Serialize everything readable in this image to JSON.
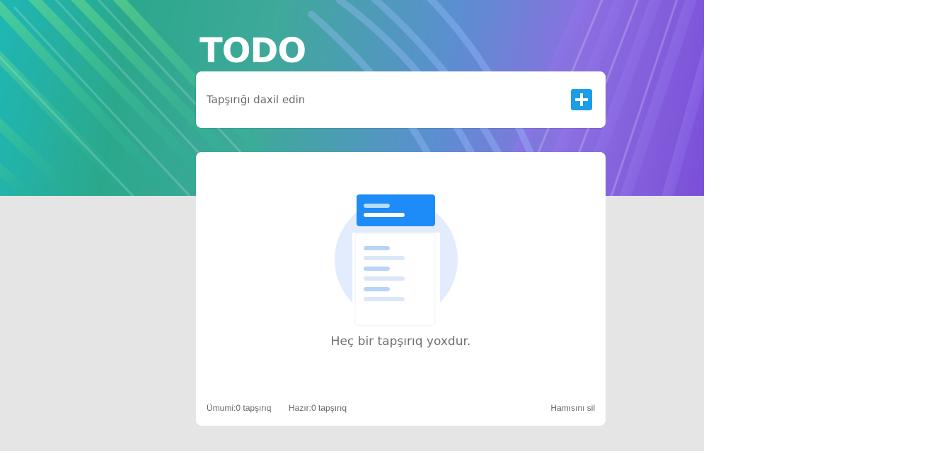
{
  "header": {
    "title": "TODO"
  },
  "task_input": {
    "placeholder": "Tapşırığı daxil edin",
    "value": ""
  },
  "add_button": {
    "icon": "plus-icon",
    "color": "#1a9ee8"
  },
  "task_list": {
    "items": [],
    "empty_message": "Heç bir tapşırıq yoxdur."
  },
  "footer": {
    "total_label": "Ümumi:",
    "total_count": "0",
    "total_unit": "tapşırıq",
    "done_label": "Hazır:",
    "done_count": "0",
    "done_unit": "tapşırıq",
    "clear_all_label": "Hamısını sil"
  },
  "colors": {
    "accent": "#1a9ee8",
    "page_background": "#e5e5e5",
    "card_background": "#ffffff"
  }
}
